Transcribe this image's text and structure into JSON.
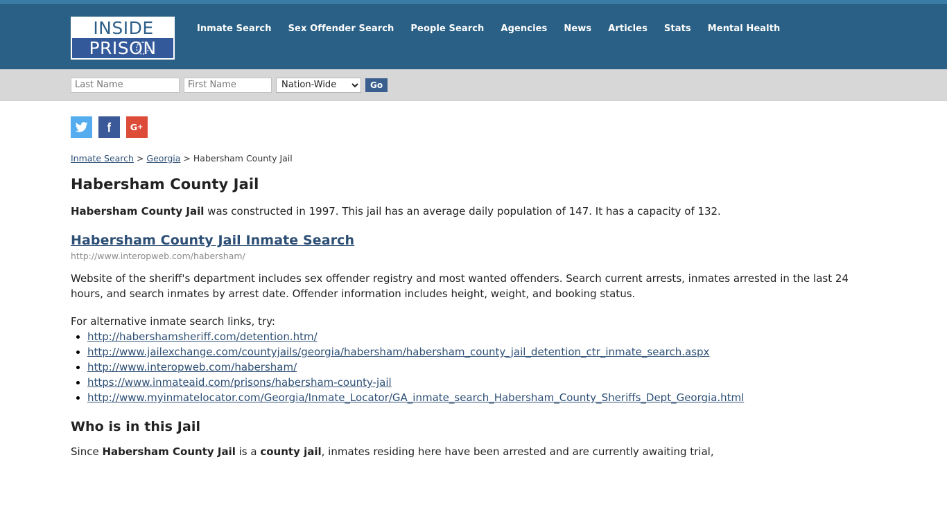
{
  "header": {
    "logo": {
      "line1": "INSIDE",
      "line2": "PRISON",
      "emblem": "circular-seal"
    },
    "nav": [
      {
        "label": "Inmate Search"
      },
      {
        "label": "Sex Offender Search"
      },
      {
        "label": "People Search"
      },
      {
        "label": "Agencies"
      },
      {
        "label": "News"
      },
      {
        "label": "Articles"
      },
      {
        "label": "Stats"
      },
      {
        "label": "Mental Health"
      }
    ],
    "bg_color": "#2a6085"
  },
  "search": {
    "last_name_placeholder": "Last Name",
    "last_name_value": "",
    "first_name_placeholder": "First Name",
    "first_name_value": "",
    "scope_selected": "Nation-Wide",
    "scope_options": [
      "Nation-Wide"
    ],
    "go_label": "Go",
    "go_color": "#3a5f8f"
  },
  "social": [
    {
      "name": "twitter",
      "color": "#55acee"
    },
    {
      "name": "facebook",
      "color": "#3b5998"
    },
    {
      "name": "googleplus",
      "color": "#dd4b39"
    }
  ],
  "breadcrumb": {
    "item1": "Inmate Search",
    "sep1": ">",
    "item2": "Georgia",
    "sep2": ">",
    "current": "Habersham County Jail"
  },
  "page": {
    "title": "Habersham County Jail",
    "intro_bold": "Habersham County Jail",
    "intro_rest": " was constructed in 1997. This jail has an average daily population of 147. It has a capacity of 132.",
    "constructed_year": "1997",
    "average_daily_population": "147",
    "capacity": "132"
  },
  "primary_link": {
    "title": "Habersham County Jail Inmate Search",
    "url": "http://www.interopweb.com/habersham/",
    "description": "Website of the sheriff's department includes sex offender registry and most wanted offenders. Search current arrests, inmates arrested in the last 24 hours, and search inmates by arrest date. Offender information includes height, weight, and booking status."
  },
  "alternatives": {
    "intro": "For alternative inmate search links, try:",
    "links": [
      "http://habershamsheriff.com/detention.htm/",
      "http://www.jailexchange.com/countyjails/georgia/habersham/habersham_county_jail_detention_ctr_inmate_search.aspx",
      "http://www.interopweb.com/habersham/",
      "https://www.inmateaid.com/prisons/habersham-county-jail",
      "http://www.myinmatelocator.com/Georgia/Inmate_Locator/GA_inmate_search_Habersham_County_Sheriffs_Dept_Georgia.html"
    ]
  },
  "who_section": {
    "heading": "Who is in this Jail",
    "text_part1": "Since ",
    "text_bold1": "Habersham County Jail",
    "text_part2": " is a ",
    "text_bold2": "county jail",
    "text_part3": ", inmates residing here have been arrested and are currently awaiting trial,"
  },
  "colors": {
    "header_bg": "#2a6085",
    "top_strip": "#3a7ca5",
    "search_band": "#d7d7d7",
    "link": "#2d4f75"
  }
}
